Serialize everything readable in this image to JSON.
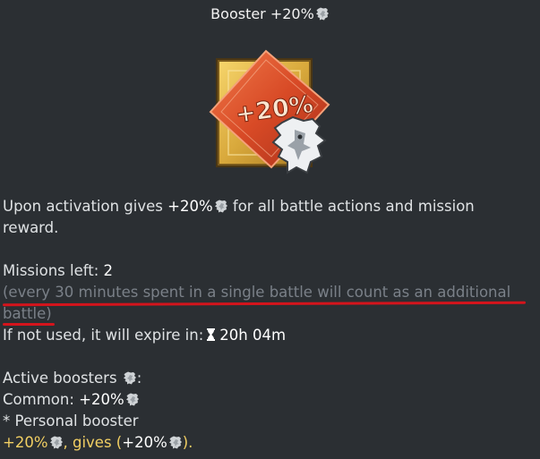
{
  "title": "Booster +20%",
  "booster_image": {
    "badge_text": "+20%"
  },
  "description": {
    "prefix": "Upon activation gives ",
    "value": "+20%",
    "suffix_line1": " for all battle actions and mission",
    "line2": "reward."
  },
  "missions": {
    "label": "Missions left: ",
    "count": "2",
    "note_line1": "(every 30 minutes spent in a single battle will count as an additional",
    "note_line2": "battle)"
  },
  "expiry": {
    "label": "If not used, it will expire in:",
    "time": "20h 04m"
  },
  "active": {
    "label": "Active boosters ",
    "colon": ":",
    "common_label": "Common: ",
    "common_value": "+20%",
    "personal_label": "* Personal booster",
    "personal_value": "+20%",
    "gives_text": ", gives (",
    "gives_value": "+20%",
    "end_text": ")."
  },
  "colors": {
    "background": "#2b2f33",
    "highlight": "#f2cf63",
    "dim_text": "#7a8088",
    "underline": "#d4141c"
  },
  "icons": [
    "lion-icon",
    "hourglass-icon",
    "booster-image"
  ]
}
